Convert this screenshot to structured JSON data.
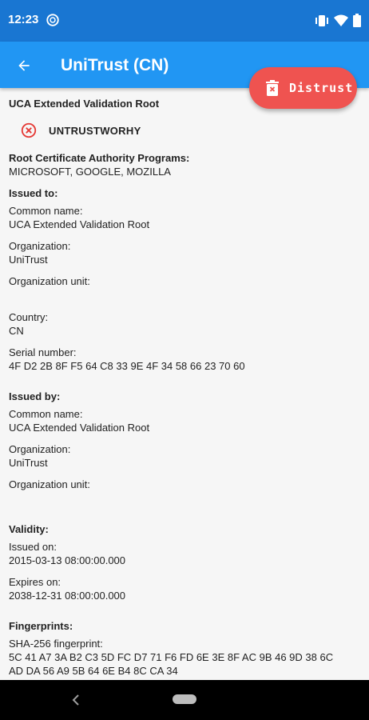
{
  "status_bar": {
    "time": "12:23",
    "icons": [
      "sync-icon",
      "vibrate-icon",
      "wifi-icon",
      "battery-icon"
    ]
  },
  "app_bar": {
    "title": "UniTrust (CN)",
    "back_icon": "arrow-back-icon"
  },
  "fab": {
    "label": "Distrust",
    "icon": "trash-x-icon",
    "color": "#ef5350"
  },
  "certificate": {
    "name": "UCA Extended Validation Root",
    "trust_status": "UNTRUSTWORHY",
    "trust_icon": "x-circle-icon",
    "programs_label": "Root Certificate Authority Programs:",
    "programs_value": "MICROSOFT, GOOGLE, MOZILLA",
    "issued_to": {
      "header": "Issued to:",
      "common_name_label": "Common name:",
      "common_name_value": "UCA Extended Validation Root",
      "organization_label": "Organization:",
      "organization_value": "UniTrust",
      "org_unit_label": "Organization unit:",
      "org_unit_value": "",
      "country_label": "Country:",
      "country_value": "CN",
      "serial_label": "Serial number:",
      "serial_value": "4F D2 2B 8F F5 64 C8 33 9E 4F 34 58 66 23 70 60"
    },
    "issued_by": {
      "header": "Issued by:",
      "common_name_label": "Common name:",
      "common_name_value": "UCA Extended Validation Root",
      "organization_label": "Organization:",
      "organization_value": "UniTrust",
      "org_unit_label": "Organization unit:",
      "org_unit_value": ""
    },
    "validity": {
      "header": "Validity:",
      "issued_on_label": "Issued on:",
      "issued_on_value": "2015-03-13 08:00:00.000",
      "expires_on_label": "Expires on:",
      "expires_on_value": "2038-12-31 08:00:00.000"
    },
    "fingerprints": {
      "header": "Fingerprints:",
      "sha256_label": "SHA-256 fingerprint:",
      "sha256_line1": "5C 41 A7 3A B2 C3 5D FC D7 71 F6 FD 6E 3E 8F AC 9B 46 9D 38 6C",
      "sha256_line2": "AD DA 56 A9 5B 64 6E B4 8C CA 34"
    }
  },
  "colors": {
    "status_bar": "#1976d2",
    "app_bar": "#2196f3",
    "accent": "#ef5350",
    "background": "#f6f6f6"
  }
}
